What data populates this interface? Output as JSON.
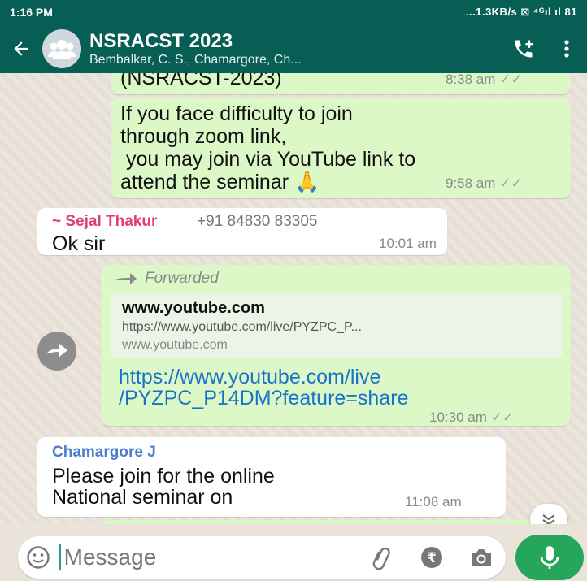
{
  "status_bar": {
    "time": "1:16 PM",
    "indicators": "...1.3KB/s ⊠ ⁴ᴳıl ıl 81"
  },
  "header": {
    "title": "NSRACST 2023",
    "subtitle": "Bembalkar, C. S., Chamargore, Ch...",
    "back_icon": "arrow-left-icon",
    "avatar_icon": "group-avatar-icon",
    "call_icon": "add-call-icon",
    "menu_icon": "more-vert-icon"
  },
  "messages": [
    {
      "type": "outgoing",
      "text": "(NSRACST-2023)",
      "time": "8:38 am"
    },
    {
      "type": "outgoing",
      "lines": [
        "If you face difficulty to join",
        "through zoom link,",
        " you may join via YouTube link to",
        "attend the seminar 🙏"
      ],
      "time": "9:58 am"
    },
    {
      "type": "incoming",
      "sender": "~ Sejal Thakur",
      "phone": "+91 84830 83305",
      "text": "Ok sir",
      "time": "10:01 am"
    },
    {
      "type": "outgoing",
      "forwarded_label": "Forwarded",
      "preview_title": "www.youtube.com",
      "preview_url": "https://www.youtube.com/live/PYZPC_P...",
      "preview_domain": "www.youtube.com",
      "link_lines": [
        "https://www.youtube.com/live",
        "/PYZPC_P14DM?feature=share"
      ],
      "time": "10:30 am"
    },
    {
      "type": "incoming",
      "sender": "Chamargore J",
      "lines": [
        "Please join for the online",
        "National seminar on"
      ],
      "time": "11:08 am"
    }
  ],
  "composer": {
    "placeholder": "Message",
    "emoji_icon": "emoji-icon",
    "attach_icon": "paperclip-icon",
    "payment_icon": "rupee-icon",
    "camera_icon": "camera-icon",
    "mic_icon": "mic-icon"
  },
  "colors": {
    "header": "#075e54",
    "outgoing_bubble": "#dcf8c6",
    "incoming_bubble": "#ffffff",
    "link": "#1a73c9",
    "sender_1": "#e0406e",
    "sender_2": "#4a7fd0",
    "mic_button": "#26a65b"
  }
}
